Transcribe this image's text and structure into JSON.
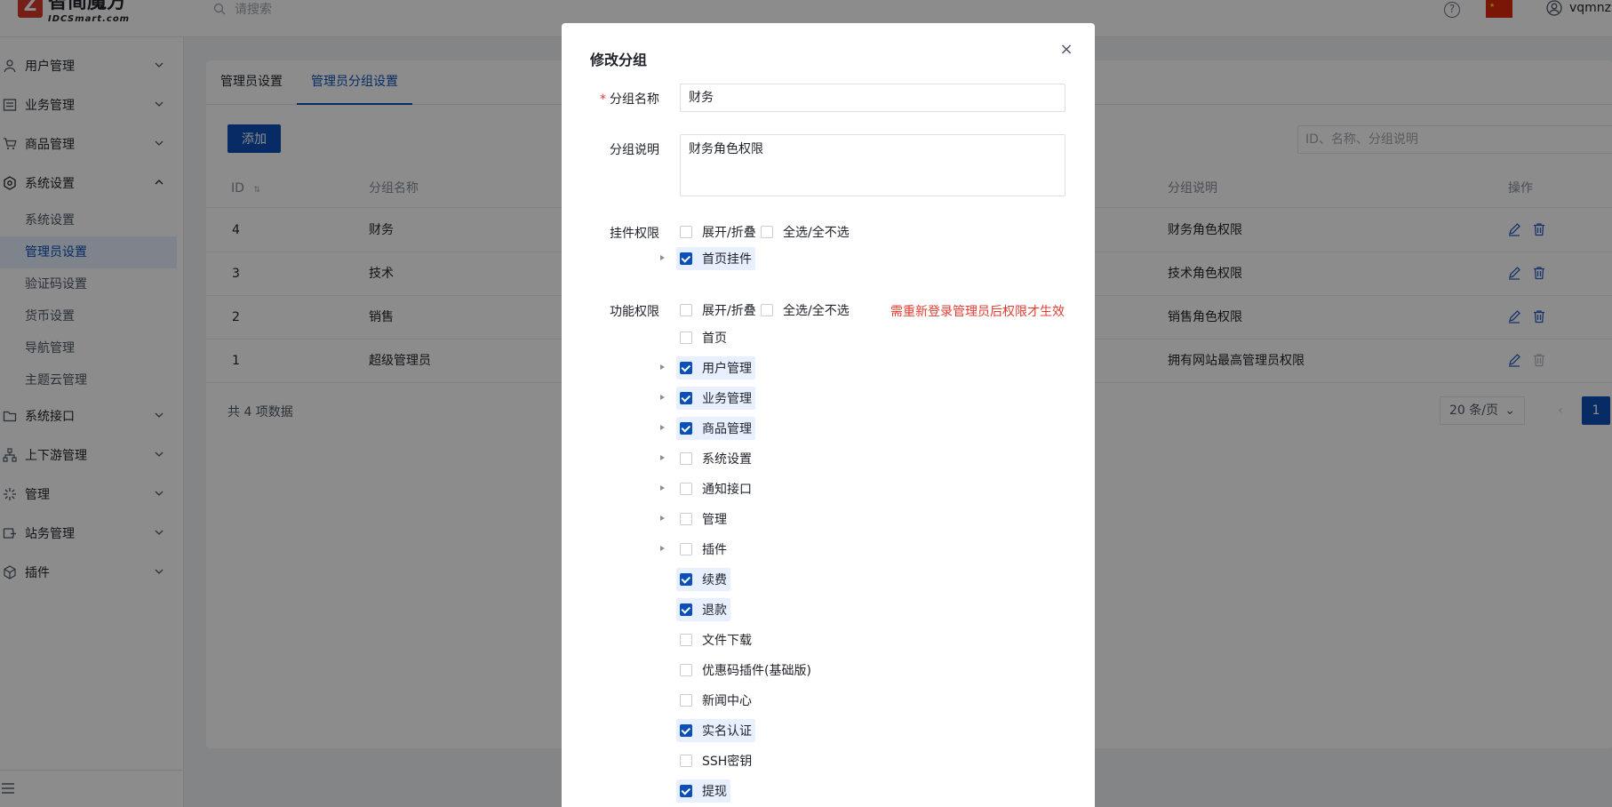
{
  "header": {
    "logo_mark": "Z",
    "logo_title": "智简魔方",
    "logo_subtitle": "IDCSmart.com",
    "search_placeholder": "请搜索",
    "help": "?",
    "username": "vqmnzl"
  },
  "sidebar": {
    "items": [
      {
        "label": "用户管理",
        "icon": "user-icon"
      },
      {
        "label": "业务管理",
        "icon": "list-icon"
      },
      {
        "label": "商品管理",
        "icon": "cart-icon"
      },
      {
        "label": "系统设置",
        "icon": "settings-icon"
      },
      {
        "label": "系统接口",
        "icon": "folder-icon"
      },
      {
        "label": "上下游管理",
        "icon": "hierarchy-icon"
      },
      {
        "label": "管理",
        "icon": "sparkle-icon"
      },
      {
        "label": "站务管理",
        "icon": "site-icon"
      },
      {
        "label": "插件",
        "icon": "cube-icon"
      }
    ],
    "sub_items": [
      {
        "label": "系统设置",
        "active": false
      },
      {
        "label": "管理员设置",
        "active": true
      },
      {
        "label": "验证码设置",
        "active": false
      },
      {
        "label": "货币设置",
        "active": false
      },
      {
        "label": "导航管理",
        "active": false
      },
      {
        "label": "主题云管理",
        "active": false
      }
    ]
  },
  "main": {
    "tabs": [
      "管理员设置",
      "管理员分组设置"
    ],
    "active_tab": 1,
    "add_button": "添加",
    "search_placeholder": "ID、名称、分组说明",
    "columns": [
      "ID",
      "分组名称",
      "分组说明",
      "操作"
    ],
    "rows": [
      {
        "id": "4",
        "name": "财务",
        "desc": "财务角色权限"
      },
      {
        "id": "3",
        "name": "技术",
        "desc": "技术角色权限"
      },
      {
        "id": "2",
        "name": "销售",
        "desc": "销售角色权限"
      },
      {
        "id": "1",
        "name": "超级管理员",
        "desc": "拥有网站最高管理员权限"
      }
    ],
    "total": "共 4 项数据",
    "page_size": "20 条/页",
    "current_page": "1"
  },
  "modal": {
    "title": "修改分组",
    "close": "×",
    "name_label": "分组名称",
    "name_value": "财务",
    "desc_label": "分组说明",
    "desc_value": "财务角色权限",
    "widget_label": "挂件权限",
    "function_label": "功能权限",
    "expand_label": "展开/折叠",
    "select_all_label": "全选/全不选",
    "warning": "需重新登录管理员后权限才生效",
    "widget_items": [
      {
        "label": "首页挂件",
        "checked": true
      }
    ],
    "function_items": [
      {
        "label": "首页",
        "checked": false
      },
      {
        "label": "用户管理",
        "checked": true
      },
      {
        "label": "业务管理",
        "checked": true
      },
      {
        "label": "商品管理",
        "checked": true
      },
      {
        "label": "系统设置",
        "checked": false
      },
      {
        "label": "通知接口",
        "checked": false
      },
      {
        "label": "管理",
        "checked": false
      },
      {
        "label": "插件",
        "checked": false
      },
      {
        "label": "续费",
        "checked": true
      },
      {
        "label": "退款",
        "checked": true
      },
      {
        "label": "文件下载",
        "checked": false
      },
      {
        "label": "优惠码插件(基础版)",
        "checked": false
      },
      {
        "label": "新闻中心",
        "checked": false
      },
      {
        "label": "实名认证",
        "checked": true
      },
      {
        "label": "SSH密钥",
        "checked": false
      },
      {
        "label": "提现",
        "checked": true
      }
    ]
  }
}
